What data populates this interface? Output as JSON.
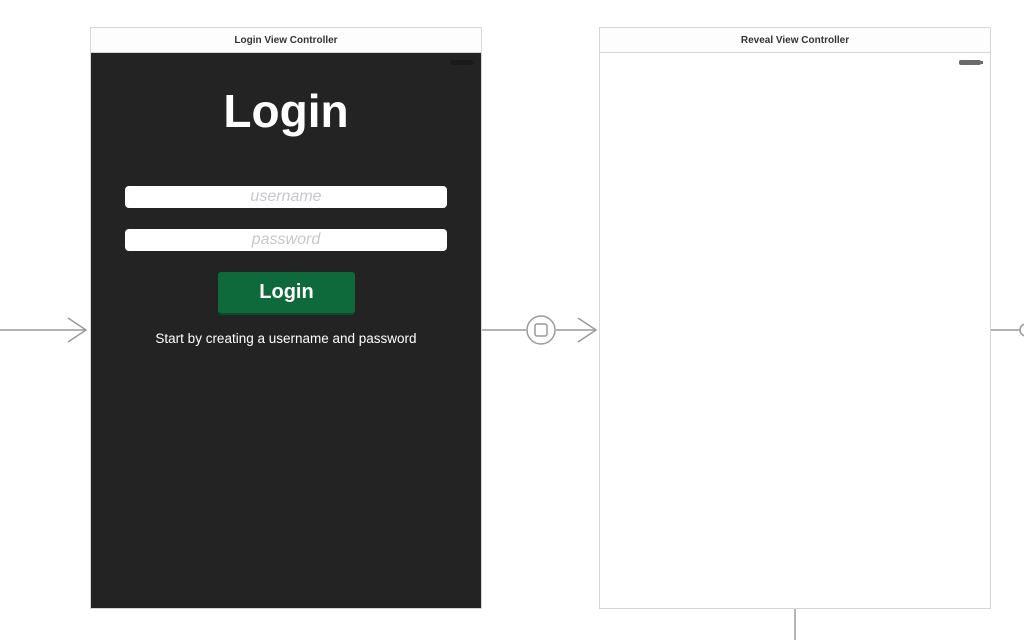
{
  "scenes": {
    "login": {
      "title": "Login View Controller",
      "heading": "Login",
      "username_placeholder": "username",
      "password_placeholder": "password",
      "button_label": "Login",
      "hint": "Start by creating a username and password"
    },
    "reveal": {
      "title": "Reveal View Controller"
    }
  },
  "colors": {
    "login_background": "#232323",
    "button_green": "#0f6a3b",
    "segue_line": "#9a9a9a"
  },
  "icons": [
    "battery-icon",
    "entry-arrow-icon",
    "segue-icon"
  ]
}
